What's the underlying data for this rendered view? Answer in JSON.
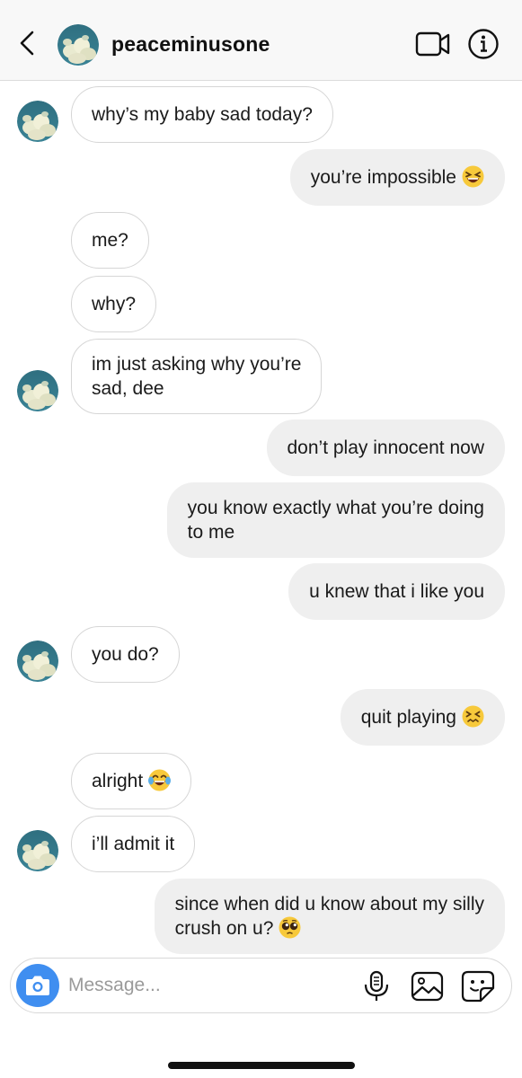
{
  "header": {
    "username": "peaceminusone",
    "back_icon": "chevron-left-icon",
    "video_icon": "video-camera-icon",
    "info_icon": "info-icon"
  },
  "messages": [
    {
      "sender": "them",
      "text": "why’s my baby sad today?"
    },
    {
      "sender": "me",
      "text": "you’re impossible",
      "emoji": "grinning-squinting-face"
    },
    {
      "sender": "them",
      "text": "me?"
    },
    {
      "sender": "them",
      "text": "why?"
    },
    {
      "sender": "them",
      "lines": [
        "im just asking why you’re",
        "sad, dee"
      ]
    },
    {
      "sender": "me",
      "text": "don’t play innocent now"
    },
    {
      "sender": "me",
      "lines": [
        "you know exactly what you’re doing",
        "to me"
      ]
    },
    {
      "sender": "me",
      "text": "u knew that i like you"
    },
    {
      "sender": "them",
      "text": "you do?"
    },
    {
      "sender": "me",
      "text": "quit playing",
      "emoji": "confounded-face"
    },
    {
      "sender": "them",
      "text": "alright",
      "emoji": "tears-of-joy-face"
    },
    {
      "sender": "them",
      "text": "i’ll admit it"
    },
    {
      "sender": "me",
      "lines": [
        "since when did u know about my silly",
        "crush on u?"
      ],
      "emoji": "pleading-face"
    }
  ],
  "composer": {
    "placeholder": "Message...",
    "value": "",
    "icons": [
      "camera-icon",
      "microphone-icon",
      "gallery-icon",
      "sticker-icon"
    ]
  },
  "colors": {
    "outgoing_bubble": "#efefef",
    "incoming_border": "#d6d6d6",
    "camera_button": "#3f8ef0"
  }
}
